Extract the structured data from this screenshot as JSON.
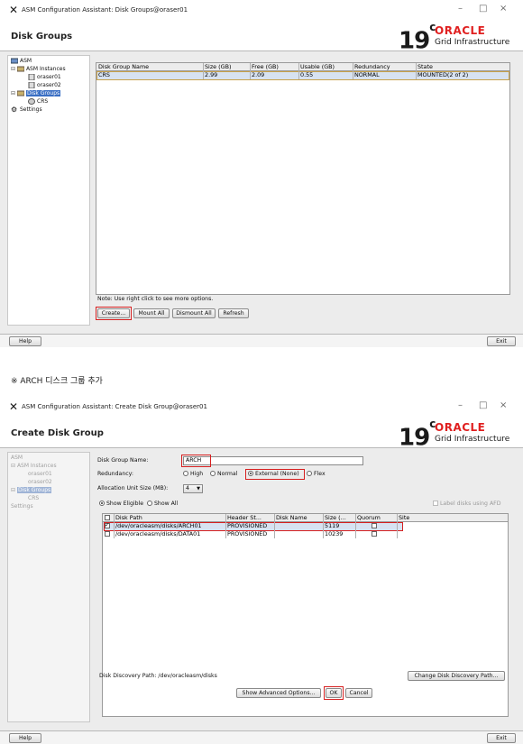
{
  "window1": {
    "title": "ASM Configuration Assistant: Disk Groups@oraser01",
    "controls": {
      "minimize": "–",
      "maximize": "□",
      "close": "×"
    },
    "header_title": "Disk Groups",
    "brand": {
      "version": "19",
      "version_sup": "c",
      "vendor": "ORACLE",
      "product": "Grid Infrastructure"
    },
    "tree": [
      {
        "label": "ASM",
        "icon": "asm-icon"
      },
      {
        "label": "ASM Instances",
        "icon": "instances-icon"
      },
      {
        "label": "oraser01",
        "icon": "instance-icon"
      },
      {
        "label": "oraser02",
        "icon": "instance-icon"
      },
      {
        "label": "Disk Groups",
        "icon": "diskgroups-icon",
        "selected": true
      },
      {
        "label": "CRS",
        "icon": "diskgroup-icon"
      },
      {
        "label": "Settings",
        "icon": "gear-icon"
      }
    ],
    "table": {
      "columns": [
        "Disk Group Name",
        "Size (GB)",
        "Free (GB)",
        "Usable (GB)",
        "Redundancy",
        "State"
      ],
      "rows": [
        [
          "CRS",
          "2.99",
          "2.09",
          "0.55",
          "NORMAL",
          "MOUNTED(2 of 2)"
        ]
      ]
    },
    "note": "Note: Use right click to see more options.",
    "buttons": {
      "create": "Create...",
      "mount_all": "Mount All",
      "dismount_all": "Dismount All",
      "refresh": "Refresh"
    },
    "footer": {
      "help": "Help",
      "exit": "Exit"
    }
  },
  "caption": "※ ARCH 디스크 그룹 추가",
  "window2": {
    "title": "ASM Configuration Assistant: Create Disk Group@oraser01",
    "controls": {
      "minimize": "–",
      "maximize": "□",
      "close": "×"
    },
    "header_title": "Create Disk Group",
    "brand": {
      "version": "19",
      "version_sup": "c",
      "vendor": "ORACLE",
      "product": "Grid Infrastructure"
    },
    "tree": [
      {
        "label": "ASM"
      },
      {
        "label": "ASM Instances"
      },
      {
        "label": "oraser01"
      },
      {
        "label": "oraser02"
      },
      {
        "label": "Disk Groups",
        "selected": true
      },
      {
        "label": "CRS"
      },
      {
        "label": "Settings"
      }
    ],
    "form": {
      "name_label": "Disk Group Name:",
      "name_value": "ARCH",
      "redundancy_label": "Redundancy:",
      "redundancy_options": [
        "High",
        "Normal",
        "External (None)",
        "Flex"
      ],
      "redundancy_selected": "External (None)",
      "au_label": "Allocation Unit Size (MB):",
      "au_value": "4",
      "show_eligible": "Show Eligible",
      "show_all": "Show All",
      "label_disks": "Label disks using AFD"
    },
    "disk_table": {
      "columns": [
        "",
        "Disk Path",
        "Header St...",
        "Disk Name",
        "Size (...",
        "Quorum",
        "Site"
      ],
      "rows": [
        {
          "checked": true,
          "path": "/dev/oracleasm/disks/ARCH01",
          "header": "PROVISIONED",
          "name": "",
          "size": "5119",
          "quorum": false,
          "site": ""
        },
        {
          "checked": false,
          "path": "/dev/oracleasm/disks/DATA01",
          "header": "PROVISIONED",
          "name": "",
          "size": "10239",
          "quorum": false,
          "site": ""
        }
      ]
    },
    "discovery_path": "Disk Discovery Path: /dev/oracleasm/disks",
    "buttons": {
      "change_path": "Change Disk Discovery Path...",
      "advanced": "Show Advanced Options...",
      "ok": "OK",
      "cancel": "Cancel"
    },
    "footer": {
      "help": "Help",
      "exit": "Exit"
    }
  }
}
